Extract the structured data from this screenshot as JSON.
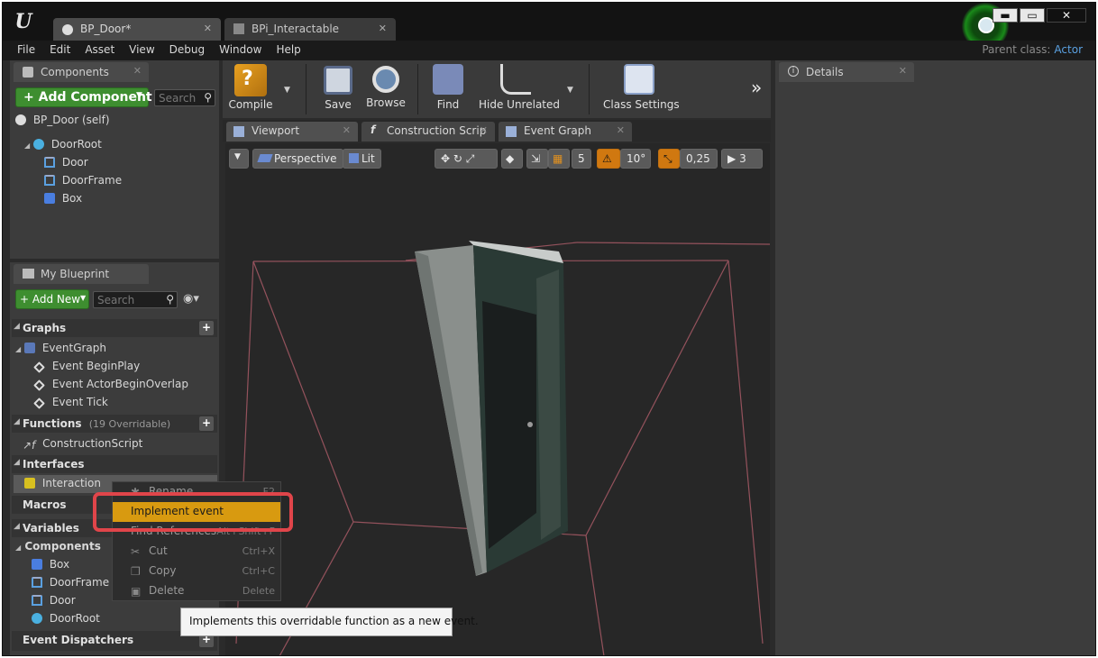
{
  "window": {
    "tabs": [
      {
        "label": "BP_Door*"
      },
      {
        "label": "BPi_Interactable"
      }
    ],
    "parent_class_label": "Parent class:",
    "parent_class_value": "Actor",
    "window_buttons": {
      "minimize": "▬",
      "maximize": "▭",
      "close": "✕"
    }
  },
  "menu": [
    "File",
    "Edit",
    "Asset",
    "View",
    "Debug",
    "Window",
    "Help"
  ],
  "components_panel": {
    "tab_label": "Components",
    "add_component_label": "+ Add Component",
    "search_placeholder": "Search",
    "self_label": "BP_Door (self)",
    "tree": [
      {
        "label": "DoorRoot",
        "icon": "scene-icon"
      },
      {
        "label": "Door",
        "icon": "mesh-icon"
      },
      {
        "label": "DoorFrame",
        "icon": "mesh-icon"
      },
      {
        "label": "Box",
        "icon": "box-collision-icon"
      }
    ]
  },
  "my_blueprint": {
    "tab_label": "My Blueprint",
    "add_new_label": "+ Add New",
    "search_placeholder": "Search",
    "graphs_label": "Graphs",
    "event_graph_label": "EventGraph",
    "events": [
      "Event BeginPlay",
      "Event ActorBeginOverlap",
      "Event Tick"
    ],
    "functions_label": "Functions",
    "functions_overridable": "(19 Overridable)",
    "construction_script_label": "ConstructionScript",
    "interfaces_label": "Interfaces",
    "interface_item": "Interaction",
    "macros_label": "Macros",
    "variables_label": "Variables",
    "components_label": "Components",
    "variable_components": [
      "Box",
      "DoorFrame",
      "Door",
      "DoorRoot"
    ],
    "event_dispatchers_label": "Event Dispatchers"
  },
  "toolbar": {
    "compile": "Compile",
    "save": "Save",
    "browse": "Browse",
    "find": "Find",
    "hide_unrelated": "Hide Unrelated",
    "class_settings": "Class Settings",
    "more": "»"
  },
  "editor_tabs": [
    "Viewport",
    "Construction Scrip",
    "Event Graph"
  ],
  "viewport": {
    "perspective": "Perspective",
    "lit": "Lit",
    "grid_snap": "5",
    "rotation_snap": "10°",
    "scale_snap": "0,25",
    "camera_speed": "3"
  },
  "details": {
    "tab_label": "Details"
  },
  "context_menu": {
    "items": [
      {
        "label": "Rename",
        "shortcut": "F2",
        "icon": "rename-icon"
      },
      {
        "label": "Implement event",
        "shortcut": "",
        "icon": ""
      },
      {
        "label": "Find References",
        "shortcut": "Alt+Shift+F",
        "icon": ""
      },
      {
        "label": "Cut",
        "shortcut": "Ctrl+X",
        "icon": "cut-icon"
      },
      {
        "label": "Copy",
        "shortcut": "Ctrl+C",
        "icon": "copy-icon"
      },
      {
        "label": "Delete",
        "shortcut": "Delete",
        "icon": "delete-icon"
      }
    ]
  },
  "tooltip": "Implements this overridable function as a new event.",
  "colors": {
    "accent_green": "#3e8e30",
    "highlight_orange": "#d89a10",
    "annotation_red": "#e0454a",
    "link_blue": "#5aa0e0"
  }
}
